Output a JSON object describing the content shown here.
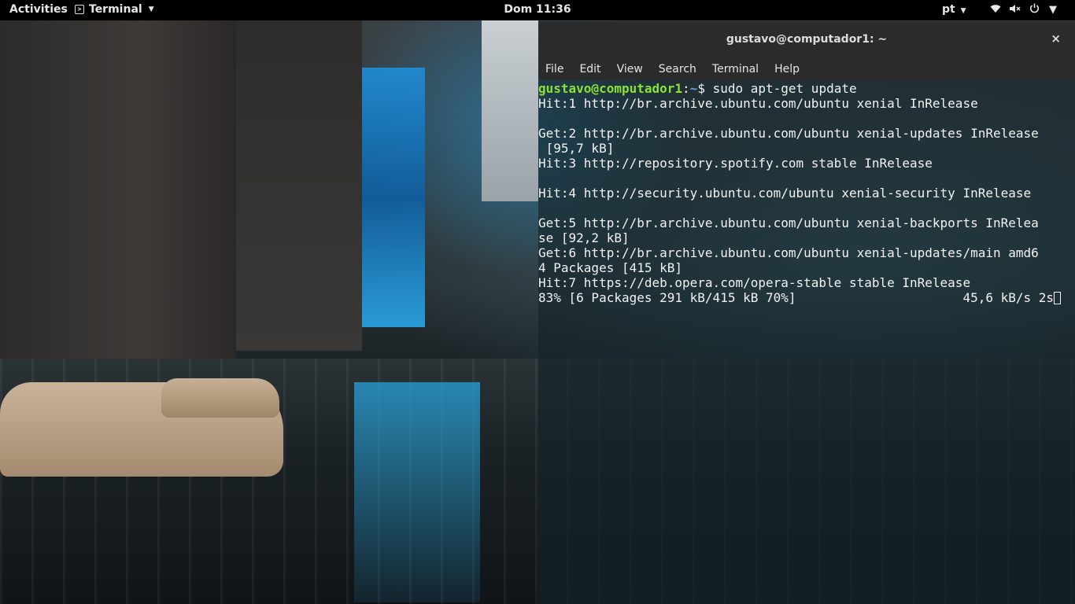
{
  "topbar": {
    "activities": "Activities",
    "app_name": "Terminal",
    "clock": "Dom 11:36",
    "language": "pt",
    "status_icons": [
      "wifi-icon",
      "volume-muted-icon",
      "power-icon"
    ]
  },
  "terminal": {
    "title": "gustavo@computador1: ~",
    "close_glyph": "×",
    "menu": [
      "File",
      "Edit",
      "View",
      "Search",
      "Terminal",
      "Help"
    ],
    "prompt_user": "gustavo@computador1",
    "prompt_sep": ":",
    "prompt_path": "~",
    "prompt_symbol": "$ ",
    "command": "sudo apt-get update",
    "output_lines": [
      "Hit:1 http://br.archive.ubuntu.com/ubuntu xenial InRelease",
      "",
      "Get:2 http://br.archive.ubuntu.com/ubuntu xenial-updates InRelease",
      " [95,7 kB]",
      "Hit:3 http://repository.spotify.com stable InRelease",
      "",
      "Hit:4 http://security.ubuntu.com/ubuntu xenial-security InRelease",
      "",
      "Get:5 http://br.archive.ubuntu.com/ubuntu xenial-backports InRelea",
      "se [92,2 kB]",
      "Get:6 http://br.archive.ubuntu.com/ubuntu xenial-updates/main amd6",
      "4 Packages [415 kB]",
      "Hit:7 https://deb.opera.com/opera-stable stable InRelease"
    ],
    "progress_line": "83% [6 Packages 291 kB/415 kB 70%]                      45,6 kB/s 2s"
  },
  "colors": {
    "prompt_user": "#8ae234",
    "prompt_path": "#729fcf",
    "topbar_bg": "#000000",
    "titlebar_bg": "#2b2b2b"
  }
}
